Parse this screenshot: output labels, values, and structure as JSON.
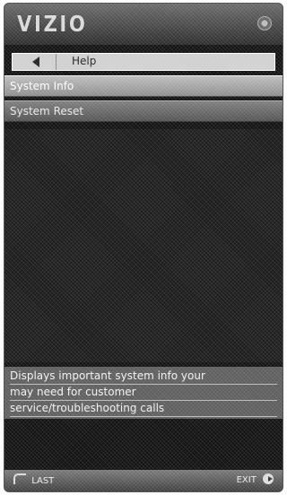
{
  "header": {
    "brand": "VIZIO"
  },
  "nav": {
    "title": "Help"
  },
  "menu": {
    "items": [
      {
        "label": "System Info",
        "state": "selected"
      },
      {
        "label": "System Reset",
        "state": "normal"
      }
    ]
  },
  "description": {
    "lines": [
      "Displays important system info your",
      "may need for customer",
      "service/troubleshooting calls"
    ]
  },
  "footer": {
    "last_label": "LAST",
    "exit_label": "EXIT"
  }
}
